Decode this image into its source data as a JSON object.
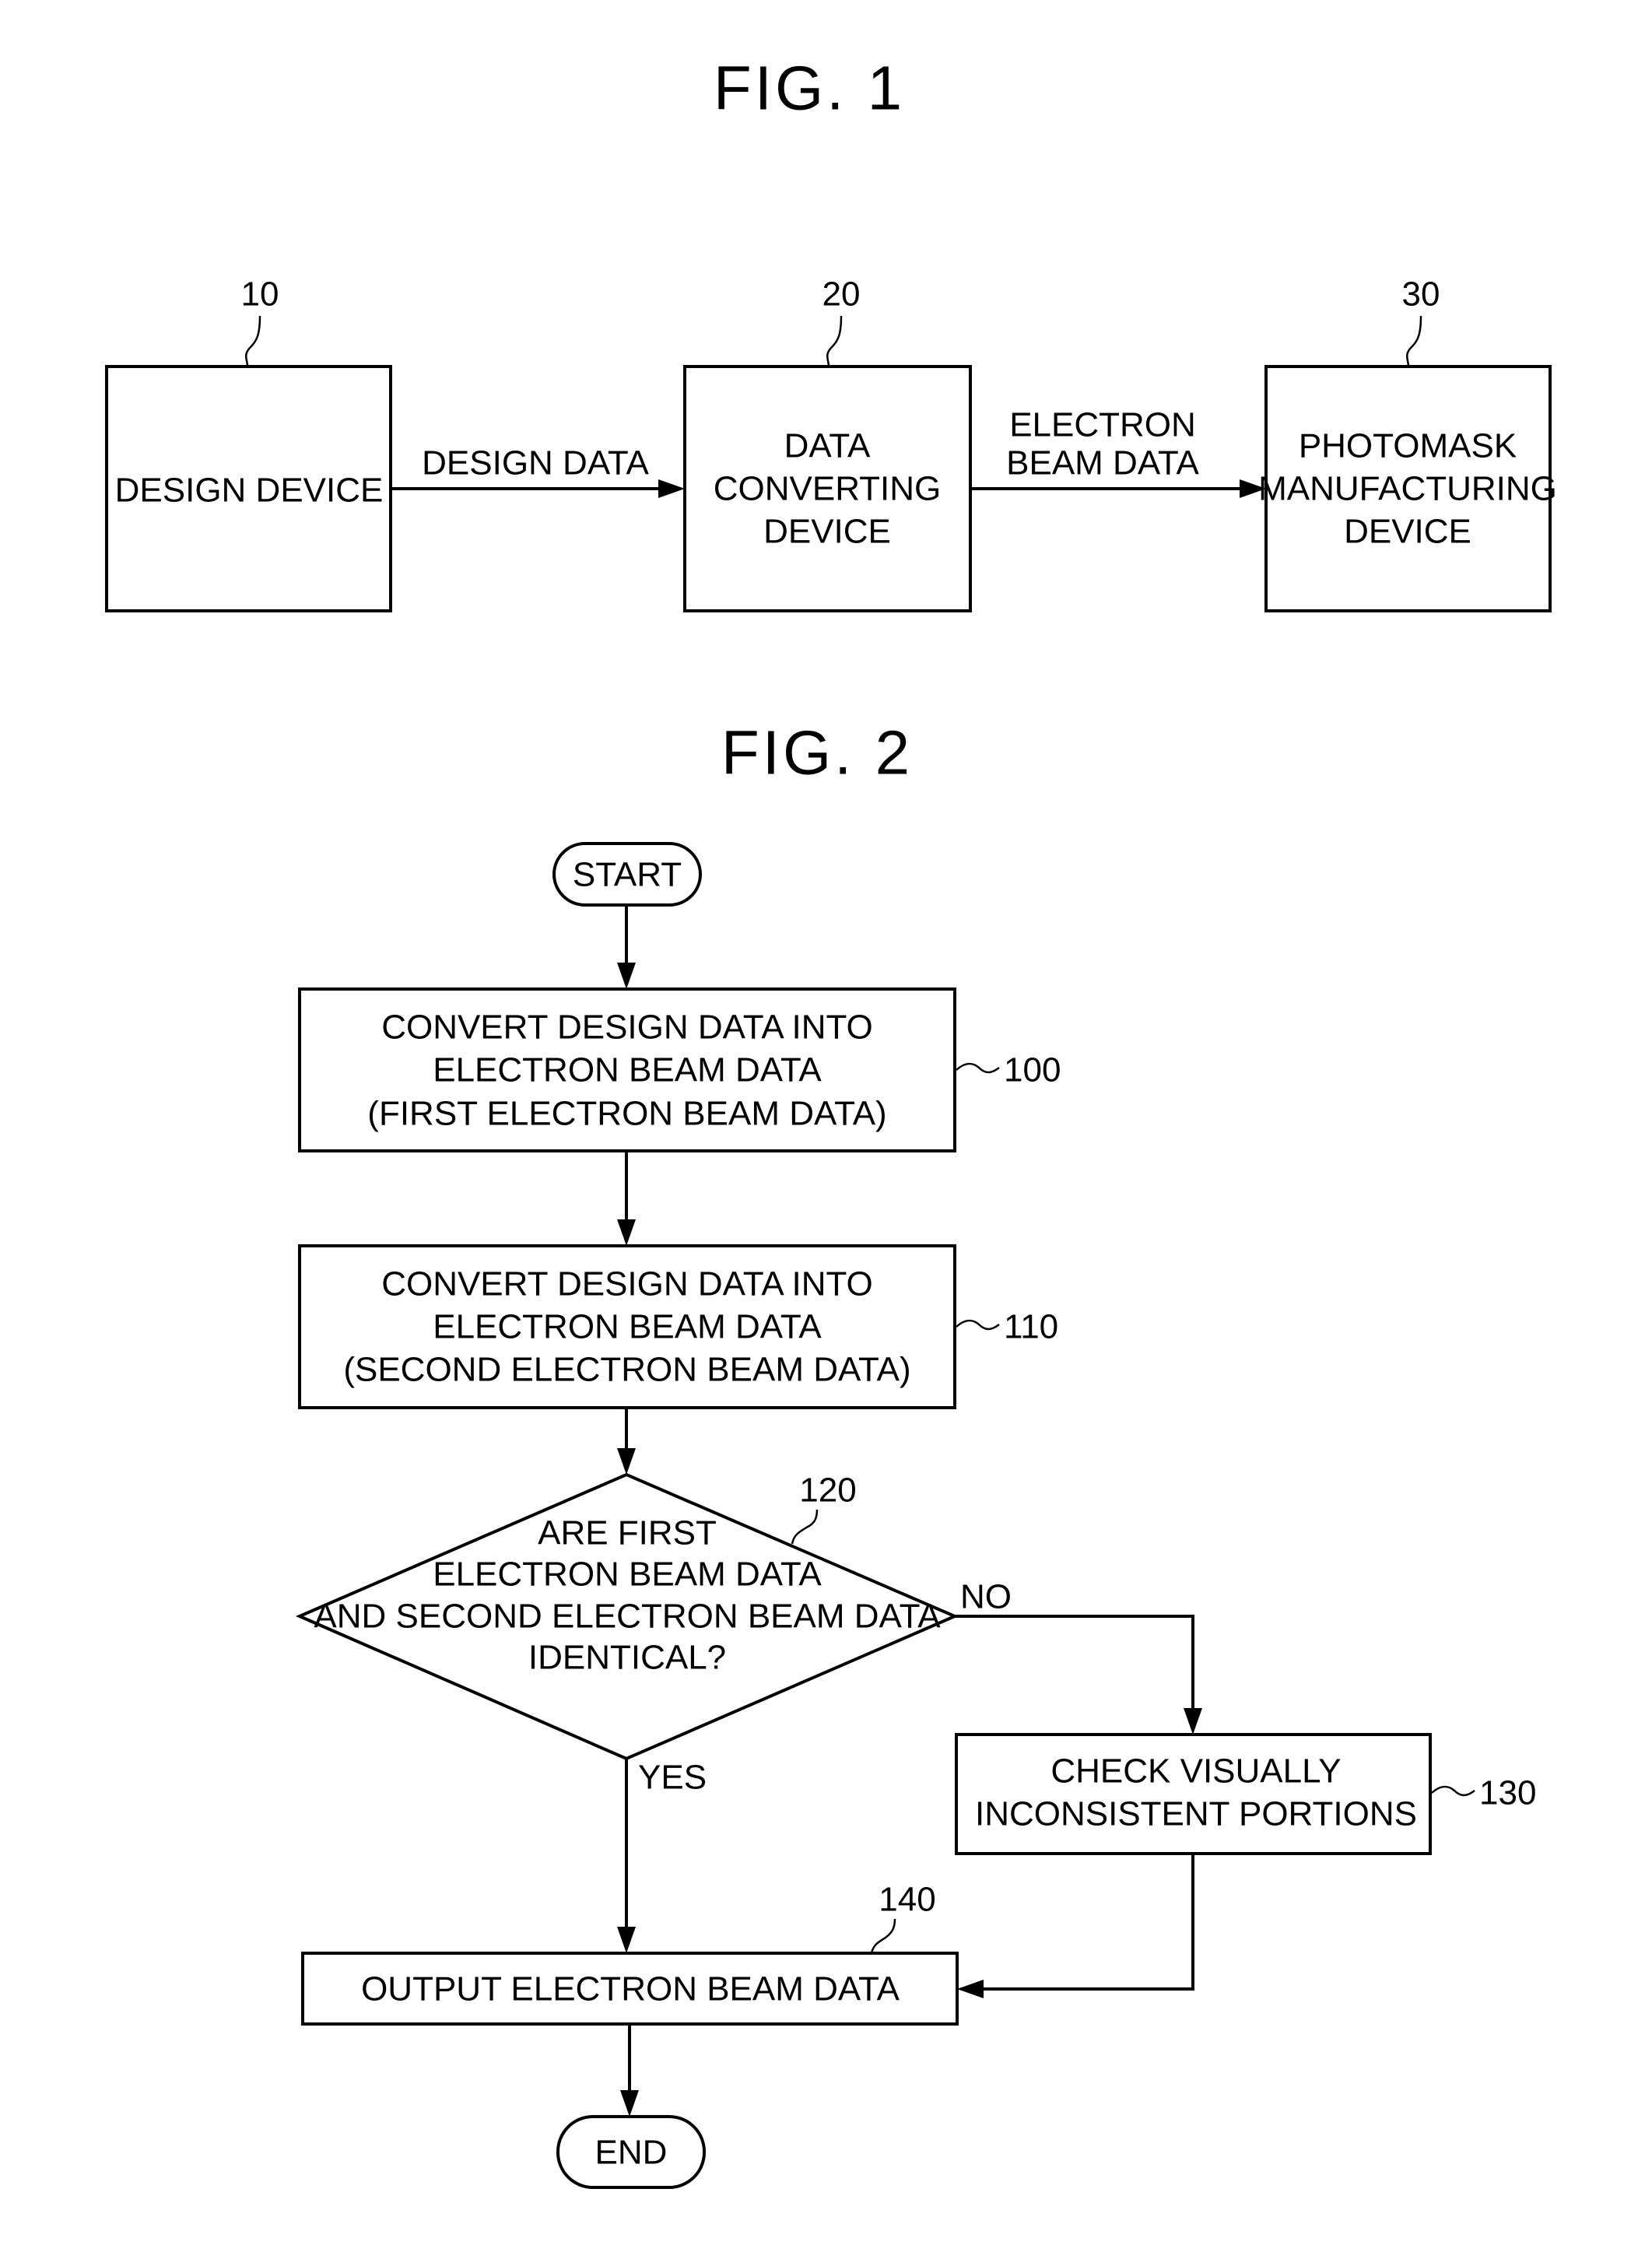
{
  "fig1": {
    "title": "FIG. 1",
    "blocks": [
      {
        "ref": "10",
        "lines": [
          "DESIGN DEVICE"
        ]
      },
      {
        "ref": "20",
        "lines": [
          "DATA",
          "CONVERTING",
          "DEVICE"
        ]
      },
      {
        "ref": "30",
        "lines": [
          "PHOTOMASK",
          "MANUFACTURING",
          "DEVICE"
        ]
      }
    ],
    "edges": [
      {
        "lines": [
          "DESIGN DATA"
        ]
      },
      {
        "lines": [
          "ELECTRON",
          "BEAM DATA"
        ]
      }
    ]
  },
  "fig2": {
    "title": "FIG. 2",
    "start": "START",
    "end": "END",
    "steps": [
      {
        "ref": "100",
        "lines": [
          "CONVERT DESIGN DATA INTO",
          "ELECTRON BEAM DATA",
          "(FIRST ELECTRON BEAM DATA)"
        ]
      },
      {
        "ref": "110",
        "lines": [
          "CONVERT DESIGN DATA INTO",
          "ELECTRON BEAM DATA",
          "(SECOND ELECTRON BEAM DATA)"
        ]
      },
      {
        "ref": "120",
        "lines": [
          "ARE FIRST",
          "ELECTRON BEAM DATA",
          "AND SECOND ELECTRON BEAM DATA",
          "IDENTICAL?"
        ]
      },
      {
        "ref": "130",
        "lines": [
          "CHECK VISUALLY",
          "INCONSISTENT PORTIONS"
        ]
      },
      {
        "ref": "140",
        "lines": [
          "OUTPUT ELECTRON BEAM DATA"
        ]
      }
    ],
    "branch_no": "NO",
    "branch_yes": "YES"
  }
}
